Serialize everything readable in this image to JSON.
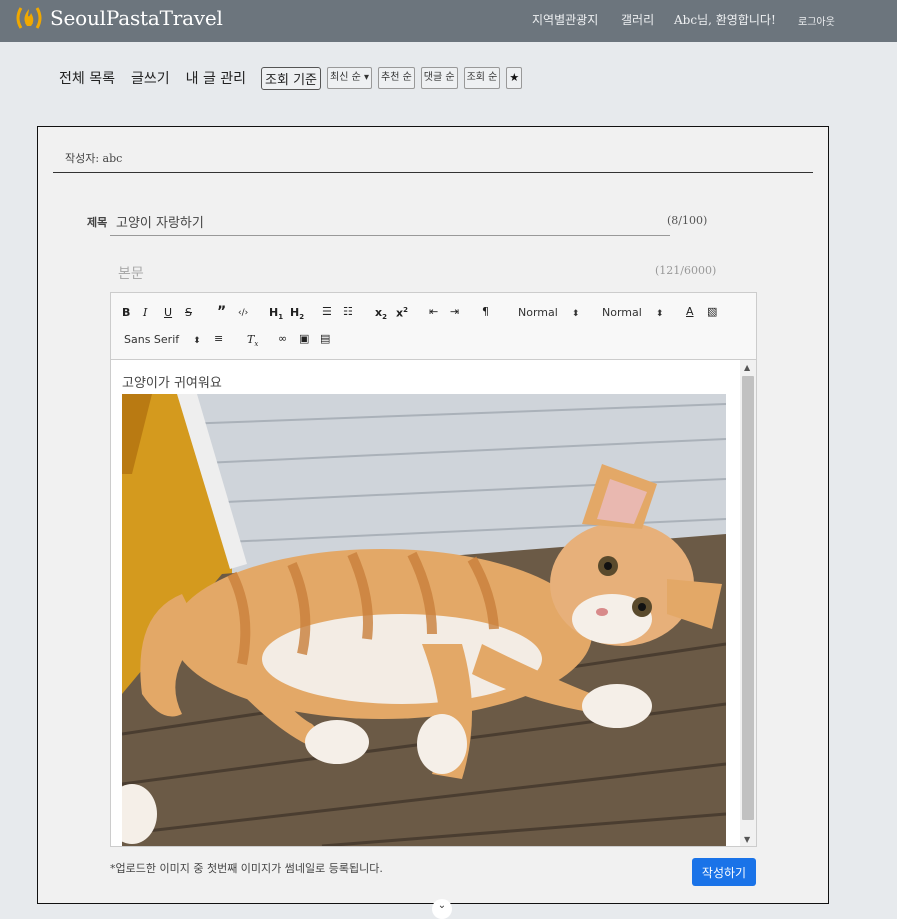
{
  "header": {
    "brand": "SeoulPastaTravel",
    "nav": {
      "regions": "지역별관광지",
      "gallery": "갤러리",
      "welcome": "Abc님, 환영합니다!",
      "logout": "로그아웃"
    }
  },
  "subnav": {
    "all_list": "전체 목록",
    "write": "글쓰기",
    "my_posts": "내 글 관리",
    "sort_label": "조회 기준",
    "sort_latest": "최신 순",
    "sort_recommend": "추천 순",
    "sort_comments": "댓글 순",
    "sort_views": "조회 순",
    "star": "★"
  },
  "form": {
    "author": "작성자: abc",
    "title_label": "제목",
    "title_value": "고양이 자랑하기",
    "title_count": "(8/100)",
    "body_placeholder": "본문",
    "body_count": "(121/6000)",
    "body_text": "고양이가 귀여워요",
    "note": "*업로드한 이미지 중 첫번째 이미지가 썸네일로 등록됩니다.",
    "submit": "작성하기"
  },
  "toolbar": {
    "header_picker": "Normal",
    "size_picker": "Normal",
    "font_picker": "Sans Serif",
    "icons": [
      "bold-icon",
      "italic-icon",
      "underline-icon",
      "strike-icon",
      "blockquote-icon",
      "code-block-icon",
      "h1-icon",
      "h2-icon",
      "ordered-list-icon",
      "bullet-list-icon",
      "subscript-icon",
      "superscript-icon",
      "outdent-icon",
      "indent-icon",
      "rtl-icon",
      "color-icon",
      "background-icon",
      "align-icon",
      "clean-icon",
      "link-icon",
      "image-icon",
      "video-icon"
    ]
  }
}
